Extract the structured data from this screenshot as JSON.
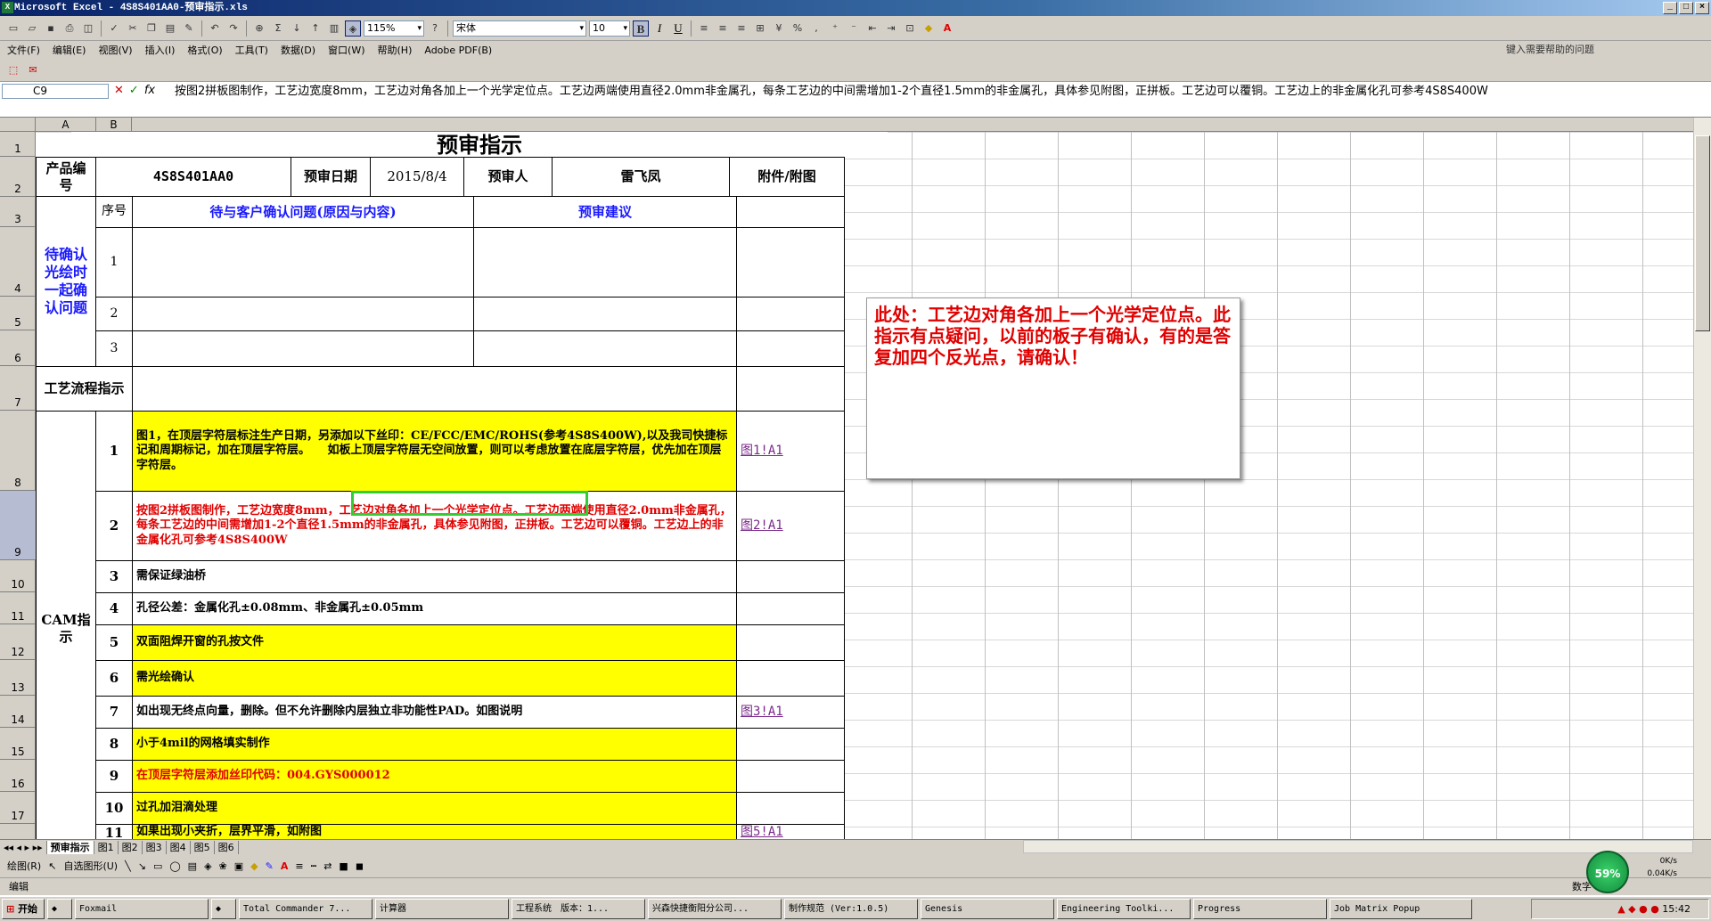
{
  "window": {
    "title": "Microsoft Excel - 4S8S401AA0-预审指示.xls"
  },
  "toolbar": {
    "zoom": "115%",
    "font": "宋体",
    "size": "10"
  },
  "menu": [
    "文件(F)",
    "编辑(E)",
    "视图(V)",
    "插入(I)",
    "格式(O)",
    "工具(T)",
    "数据(D)",
    "窗口(W)",
    "帮助(H)",
    "Adobe PDF(B)"
  ],
  "help_placeholder": "键入需要帮助的问题",
  "namebox": "C9",
  "formula": "按图2拼板图制作，工艺边宽度8mm，工艺边对角各加上一个光学定位点。工艺边两端使用直径2.0mm非金属孔，每条工艺边的中间需增加1-2个直径1.5mm的非金属孔，具体参见附图，正拼板。工艺边可以覆铜。工艺边上的非金属化孔可参考4S8S400W",
  "columns": [
    "A",
    "B"
  ],
  "rows": [
    "1",
    "2",
    "3",
    "4",
    "5",
    "6",
    "7",
    "8",
    "9",
    "10",
    "11",
    "12",
    "13",
    "14",
    "15",
    "16",
    "17"
  ],
  "sheet": {
    "title": "预审指示",
    "product_label": "产品编号",
    "product": "4S8S401AA0",
    "date_label": "预审日期",
    "date": "2015/8/4",
    "reviewer_label": "预审人",
    "reviewer": "雷飞凤",
    "attach_label": "附件/附图",
    "seq_label": "序号",
    "question_label": "待与客户确认问题(原因与内容)",
    "advice_label": "预审建议",
    "pending_label": "待确认光绘时一起确认问题",
    "pending_rows": [
      "1",
      "2",
      "3"
    ],
    "flow_label": "工艺流程指示",
    "cam_label": "CAM指示",
    "cam_rows": [
      {
        "n": "1",
        "text": "图1，在顶层字符层标注生产日期，另添加以下丝印：CE/FCC/EMC/ROHS(参考4S8S400W),以及我司快捷标记和周期标记，加在顶层字符层。　　如板上顶层字符层无空间放置，则可以考虑放置在底层字符层，优先加在顶层字符层。",
        "link": "图1!A1"
      },
      {
        "n": "2",
        "text": "按图2拼板图制作，工艺边宽度8mm，工艺边对角各加上一个光学定位点。工艺边两端使用直径2.0mm非金属孔，每条工艺边的中间需增加1-2个直径1.5mm的非金属孔，具体参见附图，正拼板。工艺边可以覆铜。工艺边上的非金属化孔可参考4S8S400W",
        "link": "图2!A1"
      },
      {
        "n": "3",
        "text": "需保证绿油桥",
        "link": ""
      },
      {
        "n": "4",
        "text": "孔径公差：金属化孔±0.08mm、非金属孔±0.05mm",
        "link": ""
      },
      {
        "n": "5",
        "text": "双面阻焊开窗的孔按文件",
        "link": ""
      },
      {
        "n": "6",
        "text": "需光绘确认",
        "link": ""
      },
      {
        "n": "7",
        "text": "如出现无终点向量，删除。但不允许删除内层独立非功能性PAD。如图说明",
        "link": "图3!A1"
      },
      {
        "n": "8",
        "text": "小于4mil的网格填实制作",
        "link": ""
      },
      {
        "n": "9",
        "text": "在顶层字符层添加丝印代码：004.GYS000012",
        "link": ""
      },
      {
        "n": "10",
        "text": "过孔加泪滴处理",
        "link": ""
      },
      {
        "n": "11",
        "text": "如果出现小夹折，层界平滑，如附图",
        "link": "图5!A1"
      }
    ]
  },
  "comment": "此处：工艺边对角各加上一个光学定位点。此指示有点疑问，以前的板子有确认，有的是答复加四个反光点，请确认！",
  "tabs": [
    "预审指示",
    "图1",
    "图2",
    "图3",
    "图4",
    "图5",
    "图6"
  ],
  "drawbar": {
    "draw": "绘图(R)",
    "autoshape": "自选图形(U)"
  },
  "status": {
    "mode": "编辑",
    "num": "数字"
  },
  "net": {
    "pct": "59%",
    "up": "0K/s",
    "down": "0.04K/s"
  },
  "taskbar": {
    "start": "开始",
    "items": [
      "Foxmail",
      "Total Commander 7...",
      "计算器",
      "工程系统　版本：1...",
      "兴森快捷衡阳分公司...",
      "制作规范 (Ver:1.0.5)",
      "Genesis",
      "Engineering Toolki...",
      "Progress",
      "Job Matrix Popup"
    ],
    "clock": "15:42"
  }
}
